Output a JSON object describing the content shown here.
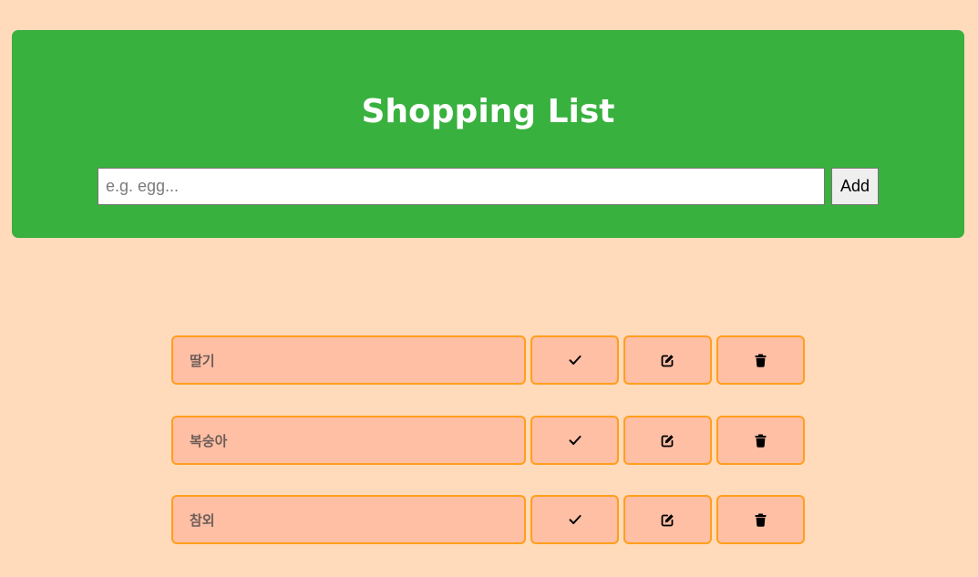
{
  "header": {
    "title": "Shopping List"
  },
  "add_form": {
    "placeholder": "e.g. egg...",
    "value": "",
    "add_label": "Add"
  },
  "items": [
    {
      "label": "딸기",
      "check_icon": "check-icon",
      "edit_icon": "edit-icon",
      "delete_icon": "trash-icon"
    },
    {
      "label": "복숭아",
      "check_icon": "check-icon",
      "edit_icon": "edit-icon",
      "delete_icon": "trash-icon"
    },
    {
      "label": "참외",
      "check_icon": "check-icon",
      "edit_icon": "edit-icon",
      "delete_icon": "trash-icon"
    }
  ],
  "colors": {
    "background": "#ffdabb",
    "header": "#38b13e",
    "item_fill": "#ffbfa5",
    "item_border": "#ff9f1c",
    "item_text": "#6d5d57"
  }
}
